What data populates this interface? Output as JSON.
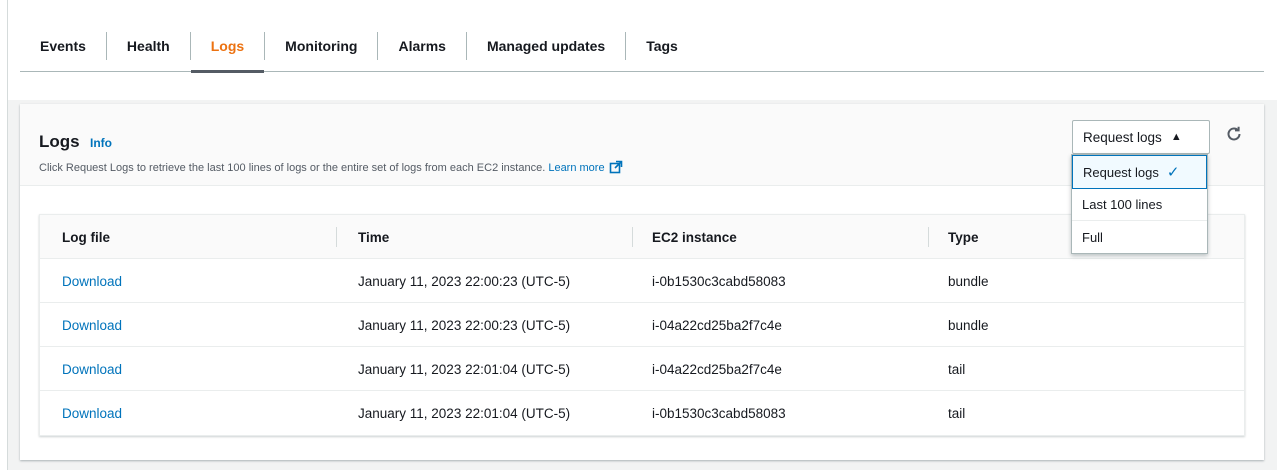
{
  "tabs": [
    {
      "label": "Events",
      "active": false
    },
    {
      "label": "Health",
      "active": false
    },
    {
      "label": "Logs",
      "active": true
    },
    {
      "label": "Monitoring",
      "active": false
    },
    {
      "label": "Alarms",
      "active": false
    },
    {
      "label": "Managed updates",
      "active": false
    },
    {
      "label": "Tags",
      "active": false
    }
  ],
  "panel": {
    "title": "Logs",
    "info_label": "Info",
    "description": "Click Request Logs to retrieve the last 100 lines of logs or the entire set of logs from each EC2 instance.",
    "learn_more": "Learn more"
  },
  "request_logs": {
    "button_label": "Request logs",
    "menu": [
      {
        "label": "Request logs",
        "selected": true
      },
      {
        "label": "Last 100 lines",
        "selected": false
      },
      {
        "label": "Full",
        "selected": false
      }
    ]
  },
  "table": {
    "columns": [
      "Log file",
      "Time",
      "EC2 instance",
      "Type"
    ],
    "rows": [
      {
        "log_file": "Download",
        "time": "January 11, 2023 22:00:23 (UTC-5)",
        "instance": "i-0b1530c3cabd58083",
        "type": "bundle"
      },
      {
        "log_file": "Download",
        "time": "January 11, 2023 22:00:23 (UTC-5)",
        "instance": "i-04a22cd25ba2f7c4e",
        "type": "bundle"
      },
      {
        "log_file": "Download",
        "time": "January 11, 2023 22:01:04 (UTC-5)",
        "instance": "i-04a22cd25ba2f7c4e",
        "type": "tail"
      },
      {
        "log_file": "Download",
        "time": "January 11, 2023 22:01:04 (UTC-5)",
        "instance": "i-0b1530c3cabd58083",
        "type": "tail"
      }
    ]
  },
  "colors": {
    "accent": "#ec7211",
    "link": "#0073bb",
    "text": "#16191f"
  }
}
